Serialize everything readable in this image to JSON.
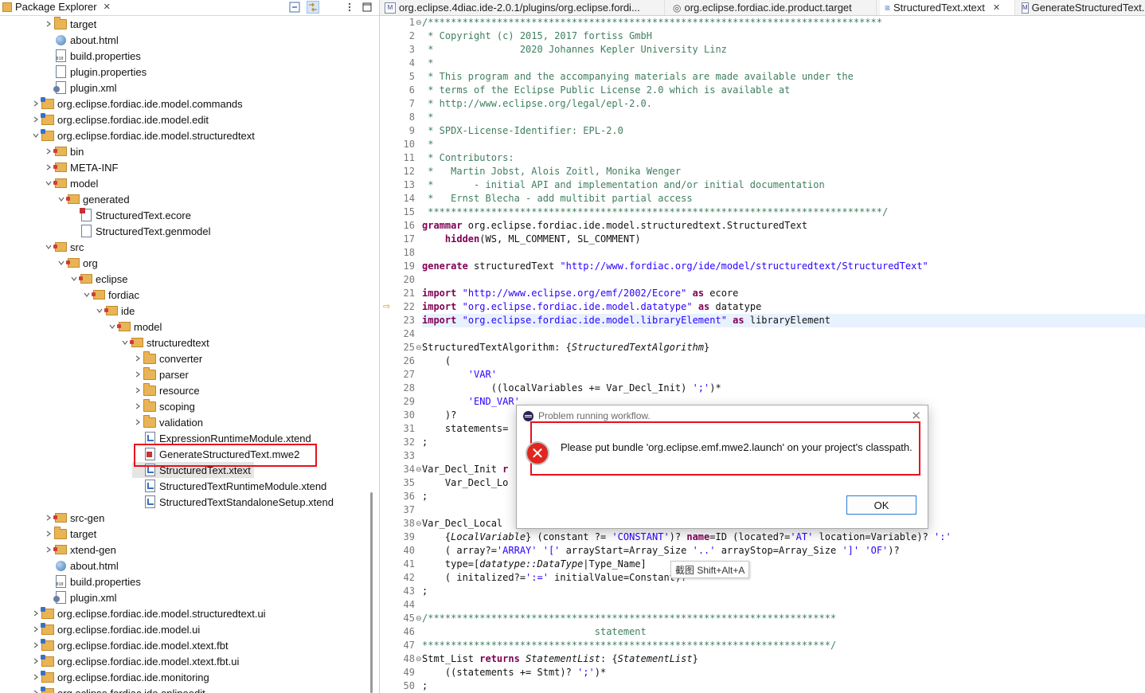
{
  "package_explorer": {
    "title": "Package Explorer",
    "close_glyph": "✕",
    "tree": [
      {
        "label": "target",
        "indent": 54,
        "icon": "folder",
        "chev": "right"
      },
      {
        "label": "about.html",
        "indent": 54,
        "icon": "globe",
        "chev": "none"
      },
      {
        "label": "build.properties",
        "indent": 54,
        "icon": "props",
        "chev": "none"
      },
      {
        "label": "plugin.properties",
        "indent": 54,
        "icon": "file",
        "chev": "none"
      },
      {
        "label": "plugin.xml",
        "indent": 54,
        "icon": "xml",
        "chev": "none"
      },
      {
        "label": "org.eclipse.fordiac.ide.model.commands",
        "indent": 38,
        "icon": "proj",
        "chev": "right"
      },
      {
        "label": "org.eclipse.fordiac.ide.model.edit",
        "indent": 38,
        "icon": "proj",
        "chev": "right"
      },
      {
        "label": "org.eclipse.fordiac.ide.model.structuredtext",
        "indent": 38,
        "icon": "proj",
        "chev": "down"
      },
      {
        "label": "bin",
        "indent": 54,
        "icon": "pkg",
        "chev": "right"
      },
      {
        "label": "META-INF",
        "indent": 54,
        "icon": "pkg",
        "chev": "right"
      },
      {
        "label": "model",
        "indent": 54,
        "icon": "pkg",
        "chev": "down"
      },
      {
        "label": "generated",
        "indent": 70,
        "icon": "pkg",
        "chev": "down"
      },
      {
        "label": "StructuredText.ecore",
        "indent": 86,
        "icon": "ecore",
        "chev": "none"
      },
      {
        "label": "StructuredText.genmodel",
        "indent": 86,
        "icon": "file",
        "chev": "none"
      },
      {
        "label": "src",
        "indent": 54,
        "icon": "pkg",
        "chev": "down"
      },
      {
        "label": "org",
        "indent": 70,
        "icon": "pkg",
        "chev": "down"
      },
      {
        "label": "eclipse",
        "indent": 86,
        "icon": "pkg",
        "chev": "down"
      },
      {
        "label": "fordiac",
        "indent": 102,
        "icon": "pkg",
        "chev": "down"
      },
      {
        "label": "ide",
        "indent": 118,
        "icon": "pkg",
        "chev": "down"
      },
      {
        "label": "model",
        "indent": 134,
        "icon": "pkg",
        "chev": "down"
      },
      {
        "label": "structuredtext",
        "indent": 150,
        "icon": "pkg",
        "chev": "down"
      },
      {
        "label": "converter",
        "indent": 166,
        "icon": "folder",
        "chev": "right"
      },
      {
        "label": "parser",
        "indent": 166,
        "icon": "folder",
        "chev": "right"
      },
      {
        "label": "resource",
        "indent": 166,
        "icon": "folder",
        "chev": "right"
      },
      {
        "label": "scoping",
        "indent": 166,
        "icon": "folder",
        "chev": "right"
      },
      {
        "label": "validation",
        "indent": 166,
        "icon": "folder",
        "chev": "right"
      },
      {
        "label": "ExpressionRuntimeModule.xtend",
        "indent": 166,
        "icon": "xt",
        "chev": "none"
      },
      {
        "label": "GenerateStructuredText.mwe2",
        "indent": 166,
        "icon": "mwe",
        "chev": "none"
      },
      {
        "label": "StructuredText.xtext",
        "indent": 166,
        "icon": "xt",
        "chev": "none",
        "selected": true
      },
      {
        "label": "StructuredTextRuntimeModule.xtend",
        "indent": 166,
        "icon": "xt",
        "chev": "none"
      },
      {
        "label": "StructuredTextStandaloneSetup.xtend",
        "indent": 166,
        "icon": "xt",
        "chev": "none"
      },
      {
        "label": "src-gen",
        "indent": 54,
        "icon": "pkg",
        "chev": "right"
      },
      {
        "label": "target",
        "indent": 54,
        "icon": "folder",
        "chev": "right"
      },
      {
        "label": "xtend-gen",
        "indent": 54,
        "icon": "pkg",
        "chev": "right"
      },
      {
        "label": "about.html",
        "indent": 54,
        "icon": "globe",
        "chev": "none"
      },
      {
        "label": "build.properties",
        "indent": 54,
        "icon": "props",
        "chev": "none"
      },
      {
        "label": "plugin.xml",
        "indent": 54,
        "icon": "xml",
        "chev": "none"
      },
      {
        "label": "org.eclipse.fordiac.ide.model.structuredtext.ui",
        "indent": 38,
        "icon": "proj",
        "chev": "right"
      },
      {
        "label": "org.eclipse.fordiac.ide.model.ui",
        "indent": 38,
        "icon": "proj",
        "chev": "right"
      },
      {
        "label": "org.eclipse.fordiac.ide.model.xtext.fbt",
        "indent": 38,
        "icon": "proj",
        "chev": "right"
      },
      {
        "label": "org.eclipse.fordiac.ide.model.xtext.fbt.ui",
        "indent": 38,
        "icon": "proj",
        "chev": "right"
      },
      {
        "label": "org.eclipse.fordiac.ide.monitoring",
        "indent": 38,
        "icon": "proj",
        "chev": "right"
      },
      {
        "label": "org.eclipse.fordiac.ide.onlineedit",
        "indent": 38,
        "icon": "proj",
        "chev": "right"
      }
    ]
  },
  "tabs": [
    {
      "label": "org.eclipse.4diac.ide-2.0.1/plugins/org.eclipse.fordi...",
      "icon": "M"
    },
    {
      "label": "org.eclipse.fordiac.ide.product.target",
      "icon": "◎"
    },
    {
      "label": "StructuredText.xtext",
      "icon": "≡",
      "active": true,
      "closable": true
    },
    {
      "label": "GenerateStructuredText.m",
      "icon": "M"
    }
  ],
  "editor": {
    "lines": [
      {
        "n": "1",
        "fold": "⊖",
        "html": "<span class=\"cmt\">/*******************************************************************************</span>"
      },
      {
        "n": "2",
        "html": "<span class=\"cmt\"> * Copyright (c) 2015, 2017 fortiss GmbH</span>"
      },
      {
        "n": "3",
        "html": "<span class=\"cmt\"> *               2020 Johannes Kepler University Linz</span>"
      },
      {
        "n": "4",
        "html": "<span class=\"cmt\"> *</span>"
      },
      {
        "n": "5",
        "html": "<span class=\"cmt\"> * This program and the accompanying materials are made available under the</span>"
      },
      {
        "n": "6",
        "html": "<span class=\"cmt\"> * terms of the Eclipse Public License 2.0 which is available at</span>"
      },
      {
        "n": "7",
        "html": "<span class=\"cmt\"> * http://www.eclipse.org/legal/epl-2.0.</span>"
      },
      {
        "n": "8",
        "html": "<span class=\"cmt\"> *</span>"
      },
      {
        "n": "9",
        "html": "<span class=\"cmt\"> * SPDX-License-Identifier: EPL-2.0</span>"
      },
      {
        "n": "10",
        "html": "<span class=\"cmt\"> *</span>"
      },
      {
        "n": "11",
        "html": "<span class=\"cmt\"> * Contributors:</span>"
      },
      {
        "n": "12",
        "html": "<span class=\"cmt\"> *   Martin Jobst, Alois Zoitl, Monika Wenger</span>"
      },
      {
        "n": "13",
        "html": "<span class=\"cmt\"> *       - initial API and implementation and/or initial documentation</span>"
      },
      {
        "n": "14",
        "html": "<span class=\"cmt\"> *   Ernst Blecha - add multibit partial access</span>"
      },
      {
        "n": "15",
        "html": "<span class=\"cmt\"> *******************************************************************************/</span>"
      },
      {
        "n": "16",
        "html": "<span class=\"kw\">grammar</span> org.eclipse.fordiac.ide.model.structuredtext.StructuredText"
      },
      {
        "n": "17",
        "html": "    <span class=\"kw\">hidden</span>(WS, ML_COMMENT, SL_COMMENT)"
      },
      {
        "n": "18",
        "html": ""
      },
      {
        "n": "19",
        "html": "<span class=\"kw\">generate</span> structuredText <span class=\"str\">\"http://www.fordiac.org/ide/model/structuredtext/StructuredText\"</span>"
      },
      {
        "n": "20",
        "html": ""
      },
      {
        "n": "21",
        "html": "<span class=\"kw\">import</span> <span class=\"str\">\"http://www.eclipse.org/emf/2002/Ecore\"</span> <span class=\"kw\">as</span> ecore"
      },
      {
        "n": "22",
        "html": "<span class=\"kw\">import</span> <span class=\"str\">\"org.eclipse.fordiac.ide.model.datatype\"</span> <span class=\"kw\">as</span> datatype"
      },
      {
        "n": "23",
        "html": "<span class=\"kw\">import</span> <span class=\"str\">\"org.eclipse.fordiac.ide.model.libraryElement\"</span> <span class=\"kw\">as</span> libraryElement"
      },
      {
        "n": "24",
        "html": ""
      },
      {
        "n": "25",
        "fold": "⊖",
        "html": "StructuredTextAlgorithm: {<span class=\"it\">StructuredTextAlgorithm</span>}"
      },
      {
        "n": "26",
        "html": "    ("
      },
      {
        "n": "27",
        "html": "        <span class=\"str\">'VAR'</span>"
      },
      {
        "n": "28",
        "html": "            ((localVariables += Var_Decl_Init) <span class=\"str\">';'</span>)*"
      },
      {
        "n": "29",
        "html": "        <span class=\"str\">'END_VAR'</span>"
      },
      {
        "n": "30",
        "html": "    )?"
      },
      {
        "n": "31",
        "html": "    statements="
      },
      {
        "n": "32",
        "html": ";"
      },
      {
        "n": "33",
        "html": ""
      },
      {
        "n": "34",
        "fold": "⊖",
        "html": "Var_Decl_Init <span class=\"kw\">r</span>"
      },
      {
        "n": "35",
        "html": "    Var_Decl_Lo"
      },
      {
        "n": "36",
        "html": ";"
      },
      {
        "n": "37",
        "html": ""
      },
      {
        "n": "38",
        "fold": "⊖",
        "html": "Var_Decl_Local"
      },
      {
        "n": "39",
        "html": "    {<span class=\"it\">LocalVariable</span>} (constant ?= <span class=\"str\">'CONSTANT'</span>)? <span class=\"kw\">name</span>=ID (located?=<span class=\"str\">'AT'</span> location=Variable)? <span class=\"str\">':'</span>"
      },
      {
        "n": "40",
        "html": "    ( array?=<span class=\"str\">'ARRAY'</span> <span class=\"str\">'['</span> arrayStart=Array_Size <span class=\"str\">'..'</span> arrayStop=Array_Size <span class=\"str\">']'</span> <span class=\"str\">'OF'</span>)?"
      },
      {
        "n": "41",
        "html": "    type=[<span class=\"it\">datatype::DataType</span>|Type_Name]"
      },
      {
        "n": "42",
        "html": "    ( initalized?=<span class=\"str\">':='</span> initialValue=Constant)?"
      },
      {
        "n": "43",
        "html": ";"
      },
      {
        "n": "44",
        "html": ""
      },
      {
        "n": "45",
        "fold": "⊖",
        "html": "<span class=\"cmt\">/***********************************************************************</span>"
      },
      {
        "n": "46",
        "html": "<span class=\"cmt\">                              statement</span>"
      },
      {
        "n": "47",
        "html": "<span class=\"cmt\">***********************************************************************/</span>"
      },
      {
        "n": "48",
        "fold": "⊖",
        "html": "Stmt_List <span class=\"kw\">returns</span> <span class=\"it\">StatementList</span>: {<span class=\"it\">StatementList</span>}"
      },
      {
        "n": "49",
        "html": "    ((statements += Stmt)? <span class=\"str\">';'</span>)*"
      },
      {
        "n": "50",
        "html": ";"
      }
    ]
  },
  "dialog": {
    "title": "Problem running workflow.",
    "message": "Please put bundle 'org.eclipse.emf.mwe2.launch' on your project's classpath.",
    "ok_label": "OK",
    "close_glyph": "✕"
  },
  "tooltip": {
    "text": "截图 Shift+Alt+A"
  },
  "colors": {
    "keyword": "#7f0055",
    "string": "#2a00ff",
    "comment": "#3f7f5f",
    "annotation_red": "#e8101a",
    "error_red": "#e0261e"
  }
}
